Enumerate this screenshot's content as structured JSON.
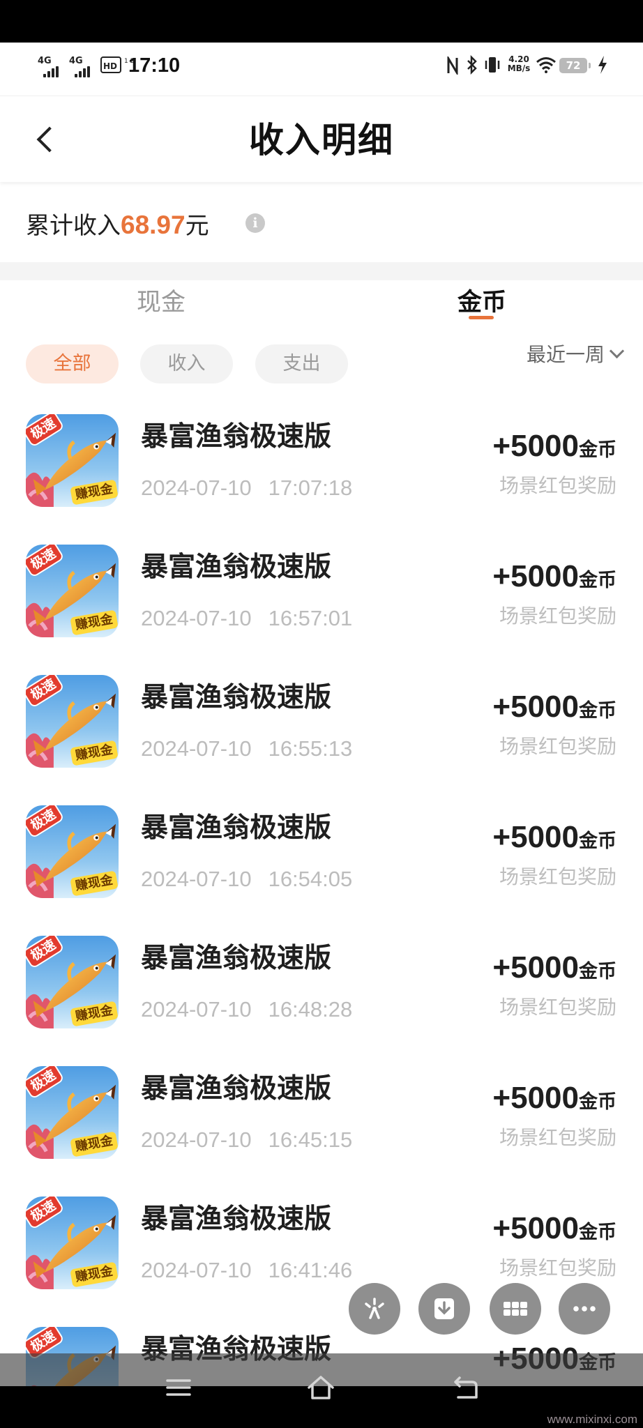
{
  "status_bar": {
    "signal_1": "4G",
    "signal_2": "4G",
    "hd": "HD",
    "hd_sub": "1 2",
    "time": "17:10",
    "speed_value": "4.20",
    "speed_unit": "MB/s",
    "battery": "72",
    "icons": [
      "signal-icon",
      "signal-icon",
      "hd-voice-icon",
      "nfc-icon",
      "bluetooth-icon",
      "vibrate-icon",
      "wifi-icon",
      "battery-icon",
      "charging-bolt-icon"
    ]
  },
  "header": {
    "title": "收入明细",
    "back_icon": "chevron-left-icon"
  },
  "summary": {
    "label": "累计收入",
    "amount": "68.97",
    "unit": "元",
    "info_icon": "info-icon"
  },
  "tabs": [
    {
      "label": "现金",
      "active": false
    },
    {
      "label": "金币",
      "active": true
    }
  ],
  "filters": [
    {
      "label": "全部",
      "active": true
    },
    {
      "label": "收入",
      "active": false
    },
    {
      "label": "支出",
      "active": false
    }
  ],
  "period": {
    "label": "最近一周",
    "icon": "chevron-down-icon"
  },
  "app_icon": {
    "badge": "极速",
    "banner": "赚现金"
  },
  "records": [
    {
      "app": "暴富渔翁极速版",
      "date": "2024-07-10",
      "time": "17:07:18",
      "amount": "+5000",
      "unit": "金币",
      "desc": "场景红包奖励"
    },
    {
      "app": "暴富渔翁极速版",
      "date": "2024-07-10",
      "time": "16:57:01",
      "amount": "+5000",
      "unit": "金币",
      "desc": "场景红包奖励"
    },
    {
      "app": "暴富渔翁极速版",
      "date": "2024-07-10",
      "time": "16:55:13",
      "amount": "+5000",
      "unit": "金币",
      "desc": "场景红包奖励"
    },
    {
      "app": "暴富渔翁极速版",
      "date": "2024-07-10",
      "time": "16:54:05",
      "amount": "+5000",
      "unit": "金币",
      "desc": "场景红包奖励"
    },
    {
      "app": "暴富渔翁极速版",
      "date": "2024-07-10",
      "time": "16:48:28",
      "amount": "+5000",
      "unit": "金币",
      "desc": "场景红包奖励"
    },
    {
      "app": "暴富渔翁极速版",
      "date": "2024-07-10",
      "time": "16:45:15",
      "amount": "+5000",
      "unit": "金币",
      "desc": "场景红包奖励"
    },
    {
      "app": "暴富渔翁极速版",
      "date": "2024-07-10",
      "time": "16:41:46",
      "amount": "+5000",
      "unit": "金币",
      "desc": "场景红包奖励"
    },
    {
      "app": "暴富渔翁极速版",
      "amount": "+5000",
      "unit": "金币"
    }
  ],
  "floating_actions": [
    "sparkle-icon",
    "download-icon",
    "grid-icon",
    "more-icon"
  ],
  "nav_bar": [
    "menu-icon",
    "home-icon",
    "back-icon"
  ],
  "watermark": "www.mixinxi.com",
  "colors": {
    "accent": "#e8743b",
    "chip_active_bg": "#fde9e0",
    "chip_bg": "#f3f3f3",
    "muted_text": "#bcbcbc",
    "separator": "#f4f4f4"
  }
}
